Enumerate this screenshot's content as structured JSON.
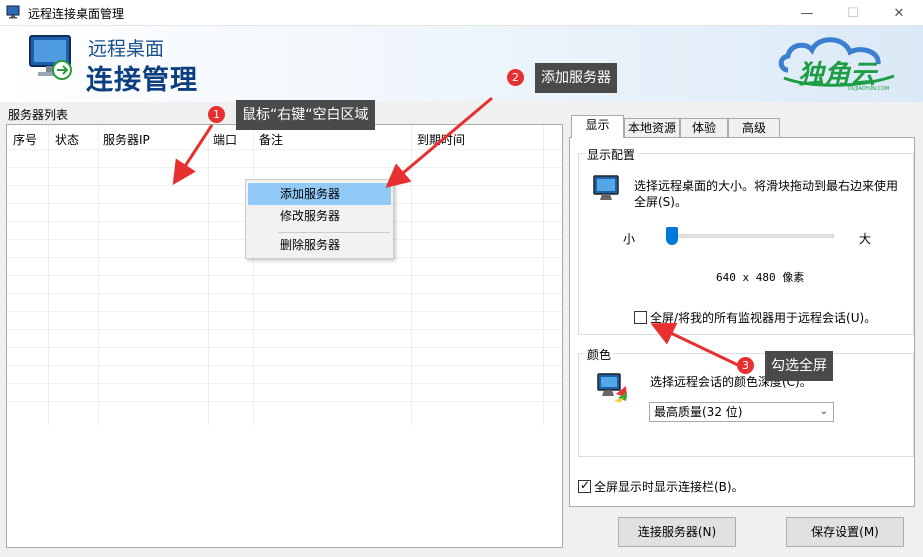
{
  "window": {
    "title": "远程连接桌面管理",
    "min_glyph": "—",
    "max_glyph": "☐",
    "close_glyph": "✕"
  },
  "banner": {
    "subtitle": "远程桌面",
    "title": "连接管理"
  },
  "brand": {
    "name": "独角云",
    "domain": "DUJIAOYUN.COM",
    "color": "#1d9d44"
  },
  "server_list": {
    "group_label": "服务器列表",
    "columns": [
      "序号",
      "状态",
      "服务器IP",
      "端口",
      "备注",
      "到期时间"
    ]
  },
  "context_menu": {
    "items": [
      {
        "label": "添加服务器",
        "highlighted": true
      },
      {
        "label": "修改服务器",
        "highlighted": false
      },
      {
        "label": "删除服务器",
        "highlighted": false
      }
    ]
  },
  "tabs": [
    {
      "label": "显示",
      "active": true
    },
    {
      "label": "本地资源",
      "active": false
    },
    {
      "label": "体验",
      "active": false
    },
    {
      "label": "高级",
      "active": false
    }
  ],
  "display": {
    "group_title": "显示配置",
    "description": "选择远程桌面的大小。将滑块拖动到最右边来使用全屏(S)。",
    "slider_min_label": "小",
    "slider_max_label": "大",
    "slider_value_fraction": 0.0,
    "resolution_text": "640 x 480 像素",
    "multimon_label": "全屏/将我的所有监视器用于远程会话(U)。",
    "multimon_checked": false
  },
  "color": {
    "group_title": "颜色",
    "description": "选择远程会话的颜色深度(C)。",
    "selected": "最高质量(32 位)"
  },
  "connection_bar": {
    "label": "全屏显示时显示连接栏(B)。",
    "checked": true
  },
  "buttons": {
    "connect": "连接服务器(N)",
    "save": "保存设置(M)"
  },
  "annotations": [
    {
      "number": "1",
      "text": "鼠标“右键“空白区域"
    },
    {
      "number": "2",
      "text": "添加服务器"
    },
    {
      "number": "3",
      "text": "勾选全屏"
    }
  ],
  "colors": {
    "accent": "#0078d7",
    "annotation_red": "#e83030",
    "banner_blue": "#0d3f80",
    "menu_highlight": "#91c9f7"
  }
}
